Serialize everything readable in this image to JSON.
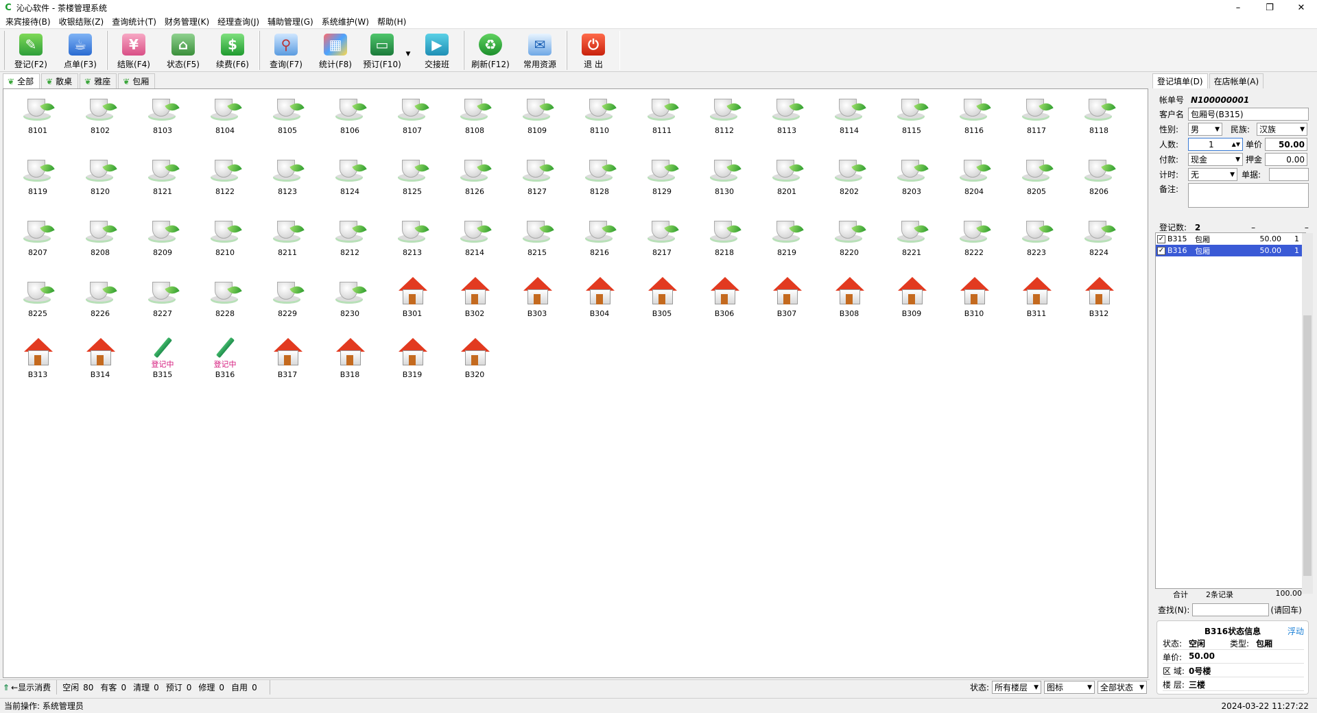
{
  "window": {
    "title": "沁心软件 - 茶楼管理系统",
    "minimize": "–",
    "maximize": "❐",
    "close": "✕"
  },
  "menu": [
    "来宾接待(B)",
    "收银结账(Z)",
    "查询统计(T)",
    "财务管理(K)",
    "经理查询(J)",
    "辅助管理(G)",
    "系统维护(W)",
    "帮助(H)"
  ],
  "toolbar": {
    "register": "登记(F2)",
    "order": "点单(F3)",
    "checkout": "结账(F4)",
    "status": "状态(F5)",
    "renew": "续费(F6)",
    "query": "查询(F7)",
    "stats": "统计(F8)",
    "reserve": "预订(F10)",
    "handover": "交接班",
    "refresh": "刷新(F12)",
    "resources": "常用资源",
    "exit": "退  出"
  },
  "tabs": [
    "全部",
    "散桌",
    "雅座",
    "包厢"
  ],
  "rooms": [
    [
      "8101",
      "cup"
    ],
    [
      "8102",
      "cup"
    ],
    [
      "8103",
      "cup"
    ],
    [
      "8104",
      "cup"
    ],
    [
      "8105",
      "cup"
    ],
    [
      "8106",
      "cup"
    ],
    [
      "8107",
      "cup"
    ],
    [
      "8108",
      "cup"
    ],
    [
      "8109",
      "cup"
    ],
    [
      "8110",
      "cup"
    ],
    [
      "8111",
      "cup"
    ],
    [
      "8112",
      "cup"
    ],
    [
      "8113",
      "cup"
    ],
    [
      "8114",
      "cup"
    ],
    [
      "8115",
      "cup"
    ],
    [
      "8116",
      "cup"
    ],
    [
      "8117",
      "cup"
    ],
    [
      "8118",
      "cup"
    ],
    [
      "8119",
      "cup"
    ],
    [
      "8120",
      "cup"
    ],
    [
      "8121",
      "cup"
    ],
    [
      "8122",
      "cup"
    ],
    [
      "8123",
      "cup"
    ],
    [
      "8124",
      "cup"
    ],
    [
      "8125",
      "cup"
    ],
    [
      "8126",
      "cup"
    ],
    [
      "8127",
      "cup"
    ],
    [
      "8128",
      "cup"
    ],
    [
      "8129",
      "cup"
    ],
    [
      "8130",
      "cup"
    ],
    [
      "8201",
      "cup"
    ],
    [
      "8202",
      "cup"
    ],
    [
      "8203",
      "cup"
    ],
    [
      "8204",
      "cup"
    ],
    [
      "8205",
      "cup"
    ],
    [
      "8206",
      "cup"
    ],
    [
      "8207",
      "cup"
    ],
    [
      "8208",
      "cup"
    ],
    [
      "8209",
      "cup"
    ],
    [
      "8210",
      "cup"
    ],
    [
      "8211",
      "cup"
    ],
    [
      "8212",
      "cup"
    ],
    [
      "8213",
      "cup"
    ],
    [
      "8214",
      "cup"
    ],
    [
      "8215",
      "cup"
    ],
    [
      "8216",
      "cup"
    ],
    [
      "8217",
      "cup"
    ],
    [
      "8218",
      "cup"
    ],
    [
      "8219",
      "cup"
    ],
    [
      "8220",
      "cup"
    ],
    [
      "8221",
      "cup"
    ],
    [
      "8222",
      "cup"
    ],
    [
      "8223",
      "cup"
    ],
    [
      "8224",
      "cup"
    ],
    [
      "8225",
      "cup"
    ],
    [
      "8226",
      "cup"
    ],
    [
      "8227",
      "cup"
    ],
    [
      "8228",
      "cup"
    ],
    [
      "8229",
      "cup"
    ],
    [
      "8230",
      "cup"
    ],
    [
      "B301",
      "house"
    ],
    [
      "B302",
      "house"
    ],
    [
      "B303",
      "house"
    ],
    [
      "B304",
      "house"
    ],
    [
      "B305",
      "house"
    ],
    [
      "B306",
      "house"
    ],
    [
      "B307",
      "house"
    ],
    [
      "B308",
      "house"
    ],
    [
      "B309",
      "house"
    ],
    [
      "B310",
      "house"
    ],
    [
      "B311",
      "house"
    ],
    [
      "B312",
      "house"
    ],
    [
      "B313",
      "house"
    ],
    [
      "B314",
      "house"
    ],
    [
      "B315",
      "registering"
    ],
    [
      "B316",
      "registering"
    ],
    [
      "B317",
      "house"
    ],
    [
      "B318",
      "house"
    ],
    [
      "B319",
      "house"
    ],
    [
      "B320",
      "house"
    ]
  ],
  "registering_label": "登记中",
  "bottombar": {
    "toggle": "←显示消费",
    "idle_label": "空闲",
    "idle": "80",
    "guest_label": "有客",
    "guest": "0",
    "clean_label": "清理",
    "clean": "0",
    "reserve_label": "预订",
    "reserve": "0",
    "repair_label": "修理",
    "repair": "0",
    "self_label": "自用",
    "self": "0",
    "status_label": "状态:",
    "floor_select": "所有楼层",
    "view_select": "图标",
    "state_select": "全部状态"
  },
  "statusbar": {
    "operator": "当前操作:  系统管理员",
    "datetime": "2024-03-22 11:27:22"
  },
  "panel": {
    "tab_register": "登记填单(D)",
    "tab_instore": "在店帐单(A)",
    "bill_label": "帐单号",
    "bill_no": "N100000001",
    "customer_label": "客户名",
    "customer": "包厢号(B315)",
    "gender_label": "性别:",
    "gender": "男",
    "ethnic_label": "民族:",
    "ethnic": "汉族",
    "people_label": "人数:",
    "people": "1",
    "price_label": "单价",
    "price": "50.00",
    "pay_label": "付款:",
    "pay": "现金",
    "deposit_label": "押金",
    "deposit": "0.00",
    "timing_label": "计时:",
    "timing": "无",
    "voucher_label": "单据:",
    "note_label": "备注:",
    "regcount_label": "登记数:",
    "regcount": "2",
    "list": [
      {
        "room": "B315",
        "type": "包厢",
        "price": "50.00",
        "qty": "1",
        "selected": false
      },
      {
        "room": "B316",
        "type": "包厢",
        "price": "50.00",
        "qty": "1",
        "selected": true
      }
    ],
    "total_label": "合计",
    "total_records": "2条记录",
    "total_amount": "100.00",
    "find_label": "查找(N):",
    "find_hint": "(请回车)",
    "info": {
      "title": "B316状态信息",
      "float": "浮动",
      "state_label": "状态:",
      "state": "空闲",
      "type_label": "类型:",
      "type": "包厢",
      "price_label": "单价:",
      "price": "50.00",
      "area_label": "区    域:",
      "area": "0号楼",
      "floor_label": "楼    层:",
      "floor": "三楼"
    }
  }
}
